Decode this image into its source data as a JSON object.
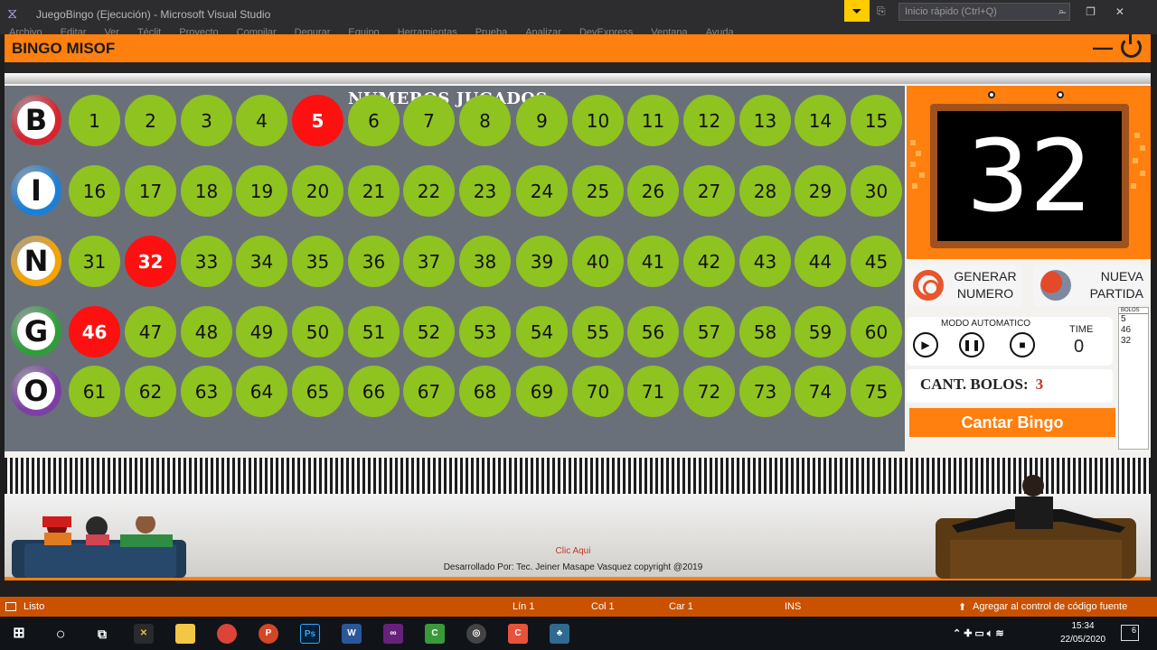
{
  "vs": {
    "title": "JuegoBingo (Ejecución) - Microsoft Visual Studio",
    "menu": [
      "Archivo",
      "Editar",
      "Ver",
      "Téclit",
      "Proyecto",
      "Compilar",
      "Depurar",
      "Equipo",
      "Herramientas",
      "Prueba",
      "Analizar",
      "DevExpress",
      "Ventana",
      "Ayuda"
    ],
    "quick_launch_placeholder": "Inicio rápido (Ctrl+Q)"
  },
  "app": {
    "title": "BINGO MISOF",
    "board_title": "NUMEROS JUGADOS",
    "letters": [
      {
        "letter": "B",
        "color": "#d9232e"
      },
      {
        "letter": "I",
        "color": "#1c7fd6"
      },
      {
        "letter": "N",
        "color": "#f5a400"
      },
      {
        "letter": "G",
        "color": "#2f9e3a"
      },
      {
        "letter": "O",
        "color": "#7d3fa6"
      }
    ],
    "called_numbers": [
      5,
      32,
      46
    ],
    "current_number": "32",
    "generate_button": {
      "line1": "GENERAR",
      "line2": "NUMERO"
    },
    "new_game_button": {
      "line1": "NUEVA",
      "line2": "PARTIDA"
    },
    "auto_mode": {
      "label": "MODO AUTOMATICO",
      "time_label": "TIME",
      "time_value": "0"
    },
    "count": {
      "label": "CANT. BOLOS:",
      "value": "3"
    },
    "cantar_button": "Cantar Bingo",
    "bolos": {
      "header": "BOLOS",
      "items": [
        "5",
        "46",
        "32"
      ]
    },
    "clic_link": "Clic Aqui",
    "credit": "Desarrollado Por: Tec. Jeiner Masape Vasquez copyright @2019"
  },
  "status_bar": {
    "ready": "Listo",
    "line": "Lín 1",
    "col": "Col 1",
    "car": "Car 1",
    "ins": "INS",
    "source_control": "Agregar al control de código fuente"
  },
  "taskbar": {
    "time": "15:34",
    "date": "22/05/2020",
    "notifications": "6"
  },
  "colors": {
    "accent": "#ff7f0f",
    "ball": "#8fc31f",
    "ball_called": "#ff1010",
    "board_bg": "#6a7079",
    "statusbar": "#ca5100"
  }
}
